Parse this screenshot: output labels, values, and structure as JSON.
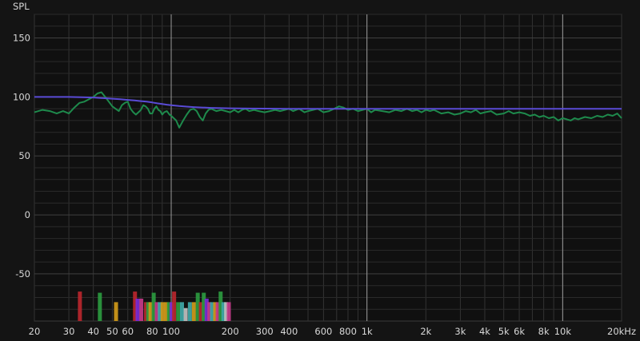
{
  "chart_data": {
    "type": "line",
    "title": "",
    "ylabel": "SPL",
    "xlabel": "",
    "x_scale": "log",
    "xlim": [
      20,
      20000
    ],
    "ylim": [
      -90,
      170
    ],
    "grid": true,
    "x_tick_labels": [
      {
        "value": 20,
        "label": "20"
      },
      {
        "value": 30,
        "label": "30"
      },
      {
        "value": 40,
        "label": "40"
      },
      {
        "value": 50,
        "label": "50"
      },
      {
        "value": 60,
        "label": "60"
      },
      {
        "value": 80,
        "label": "80"
      },
      {
        "value": 100,
        "label": "100"
      },
      {
        "value": 200,
        "label": "200"
      },
      {
        "value": 300,
        "label": "300"
      },
      {
        "value": 400,
        "label": "400"
      },
      {
        "value": 600,
        "label": "600"
      },
      {
        "value": 800,
        "label": "800"
      },
      {
        "value": 1000,
        "label": "1k"
      },
      {
        "value": 2000,
        "label": "2k"
      },
      {
        "value": 3000,
        "label": "3k"
      },
      {
        "value": 4000,
        "label": "4k"
      },
      {
        "value": 5000,
        "label": "5k"
      },
      {
        "value": 6000,
        "label": "6k"
      },
      {
        "value": 8000,
        "label": "8k"
      },
      {
        "value": 10000,
        "label": "10k"
      },
      {
        "value": 20000,
        "label": "20kHz"
      }
    ],
    "y_ticks": [
      150,
      100,
      50,
      0,
      -50
    ],
    "x_highlight_lines": [
      100,
      1000,
      10000
    ],
    "series": [
      {
        "key": "measured",
        "color": "#1e8a4c",
        "x": [
          20,
          22,
          24,
          26,
          28,
          30,
          32,
          34,
          36,
          38,
          40,
          42,
          44,
          46,
          48,
          50,
          52,
          54,
          56,
          58,
          60,
          62,
          64,
          66,
          68,
          70,
          72,
          74,
          76,
          78,
          80,
          82,
          84,
          86,
          88,
          90,
          92,
          95,
          98,
          100,
          103,
          106,
          110,
          115,
          120,
          125,
          130,
          135,
          140,
          145,
          150,
          155,
          160,
          170,
          180,
          190,
          200,
          210,
          220,
          230,
          240,
          250,
          265,
          280,
          300,
          320,
          340,
          360,
          380,
          400,
          420,
          450,
          480,
          500,
          530,
          560,
          600,
          640,
          680,
          720,
          760,
          800,
          850,
          900,
          950,
          1000,
          1050,
          1100,
          1200,
          1300,
          1400,
          1500,
          1600,
          1700,
          1800,
          1900,
          2000,
          2100,
          2200,
          2400,
          2600,
          2800,
          3000,
          3200,
          3400,
          3600,
          3800,
          4000,
          4300,
          4600,
          5000,
          5300,
          5600,
          6000,
          6400,
          6800,
          7200,
          7600,
          8000,
          8500,
          9000,
          9500,
          10000,
          10500,
          11000,
          11500,
          12000,
          13000,
          14000,
          15000,
          16000,
          17000,
          18000,
          19000,
          20000
        ],
        "y": [
          87,
          89,
          88,
          86,
          88,
          86,
          91,
          95,
          96,
          98,
          100,
          103,
          104,
          100,
          96,
          92,
          90,
          88,
          93,
          95,
          96,
          90,
          87,
          85,
          87,
          89,
          93,
          92,
          90,
          86,
          86,
          90,
          92,
          89,
          88,
          85,
          87,
          88,
          85,
          84,
          82,
          80,
          74,
          80,
          85,
          89,
          90,
          88,
          83,
          80,
          86,
          89,
          90,
          88,
          89,
          88,
          87,
          89,
          87,
          89,
          90,
          88,
          89,
          88,
          87,
          88,
          89,
          88,
          89,
          90,
          88,
          90,
          87,
          88,
          89,
          90,
          87,
          88,
          90,
          92,
          91,
          89,
          90,
          88,
          89,
          90,
          87,
          89,
          88,
          87,
          89,
          88,
          90,
          88,
          89,
          87,
          89,
          88,
          89,
          86,
          87,
          85,
          86,
          88,
          87,
          89,
          86,
          87,
          88,
          85,
          86,
          88,
          86,
          87,
          86,
          84,
          85,
          83,
          84,
          82,
          83,
          80,
          82,
          81,
          80,
          82,
          81,
          83,
          82,
          84,
          83,
          85,
          84,
          86,
          82
        ]
      },
      {
        "key": "target",
        "color": "#5a4bd6",
        "x": [
          20,
          25,
          30,
          35,
          40,
          45,
          50,
          55,
          60,
          65,
          70,
          75,
          80,
          85,
          90,
          95,
          100,
          110,
          120,
          130,
          140,
          150,
          160,
          180,
          200,
          250,
          300,
          400,
          500,
          700,
          1000,
          2000,
          5000,
          10000,
          20000
        ],
        "y": [
          100,
          100,
          100,
          99.8,
          99.5,
          99,
          98.5,
          98,
          97.5,
          97,
          96.5,
          96,
          95.3,
          94.6,
          94,
          93.4,
          93,
          92.3,
          91.8,
          91.4,
          91.1,
          90.9,
          90.7,
          90.5,
          90.4,
          90.2,
          90.1,
          90,
          90,
          90,
          90,
          90,
          90,
          90,
          90
        ]
      }
    ],
    "filter_bars": [
      {
        "f": 34,
        "top": -65,
        "color": "#b8262c"
      },
      {
        "f": 43,
        "top": -66,
        "color": "#2b9a3f"
      },
      {
        "f": 52,
        "top": -74,
        "color": "#d09a1a"
      },
      {
        "f": 65,
        "top": -65,
        "color": "#b8262c"
      },
      {
        "f": 67,
        "top": -71,
        "color": "#7a2bd6"
      },
      {
        "f": 70,
        "top": -71,
        "color": "#c43a8a"
      },
      {
        "f": 74,
        "top": -74,
        "color": "#b8262c"
      },
      {
        "f": 76,
        "top": -74,
        "color": "#2b9a3f"
      },
      {
        "f": 78,
        "top": -74,
        "color": "#d09a1a"
      },
      {
        "f": 81,
        "top": -66,
        "color": "#2b9a3f"
      },
      {
        "f": 84,
        "top": -74,
        "color": "#c43a8a"
      },
      {
        "f": 87,
        "top": -74,
        "color": "#3fa8a8"
      },
      {
        "f": 90,
        "top": -74,
        "color": "#d09a1a"
      },
      {
        "f": 94,
        "top": -74,
        "color": "#d09a1a"
      },
      {
        "f": 97,
        "top": -74,
        "color": "#2b9a3f"
      },
      {
        "f": 100,
        "top": -74,
        "color": "#7a2bd6"
      },
      {
        "f": 103,
        "top": -65,
        "color": "#b8262c"
      },
      {
        "f": 108,
        "top": -74,
        "color": "#2b9a3f"
      },
      {
        "f": 113,
        "top": -74,
        "color": "#3fa8a8"
      },
      {
        "f": 118,
        "top": -79,
        "color": "#c0c0c0"
      },
      {
        "f": 124,
        "top": -74,
        "color": "#3fa8a8"
      },
      {
        "f": 130,
        "top": -74,
        "color": "#d09a1a"
      },
      {
        "f": 136,
        "top": -66,
        "color": "#2b9a3f"
      },
      {
        "f": 141,
        "top": -74,
        "color": "#b8262c"
      },
      {
        "f": 146,
        "top": -66,
        "color": "#2b9a3f"
      },
      {
        "f": 151,
        "top": -71,
        "color": "#7a2bd6"
      },
      {
        "f": 156,
        "top": -74,
        "color": "#c43a8a"
      },
      {
        "f": 161,
        "top": -74,
        "color": "#3fa8a8"
      },
      {
        "f": 167,
        "top": -74,
        "color": "#d09a1a"
      },
      {
        "f": 172,
        "top": -74,
        "color": "#c43a8a"
      },
      {
        "f": 178,
        "top": -65,
        "color": "#2b9a3f"
      },
      {
        "f": 184,
        "top": -74,
        "color": "#3fa8a8"
      },
      {
        "f": 190,
        "top": -74,
        "color": "#c0c0c0"
      },
      {
        "f": 196,
        "top": -74,
        "color": "#c43a8a"
      }
    ]
  }
}
